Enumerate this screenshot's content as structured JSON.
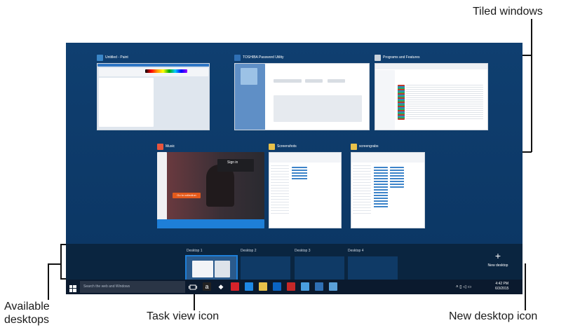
{
  "callouts": {
    "tiled_windows": "Tiled windows",
    "available_desktops": "Available\ndesktops",
    "task_view_icon": "Task view icon",
    "new_desktop_icon": "New desktop icon"
  },
  "windows": [
    {
      "title": "Untitled - Paint",
      "icon": "paint-icon",
      "color": "#3a86c8"
    },
    {
      "title": "TOSHIBA Password Utility",
      "icon": "toshiba-icon",
      "color": "#2f6fb4"
    },
    {
      "title": "Programs and Features",
      "icon": "programs-icon",
      "color": "#c9d2dc"
    },
    {
      "title": "Music",
      "icon": "music-icon",
      "color": "#e8553d"
    },
    {
      "title": "Screenshots",
      "icon": "folder-icon",
      "color": "#e8c14a"
    },
    {
      "title": "screengrabs",
      "icon": "folder-icon",
      "color": "#e8c14a"
    }
  ],
  "music": {
    "sign_in": "Sign in",
    "button": "Go to collection"
  },
  "desktops": [
    "Desktop 1",
    "Desktop 2",
    "Desktop 3",
    "Desktop 4"
  ],
  "new_desktop": {
    "symbol": "+",
    "label": "New desktop"
  },
  "taskbar": {
    "search_placeholder": "Search the web and Windows",
    "time": "4:42 PM",
    "date": "6/3/2015"
  },
  "colors": {
    "screen_bg": "#0d3c6c",
    "desktop_bar": "#0a2540",
    "taskbar": "#0b1a2e",
    "accent": "#1e7fd8"
  }
}
